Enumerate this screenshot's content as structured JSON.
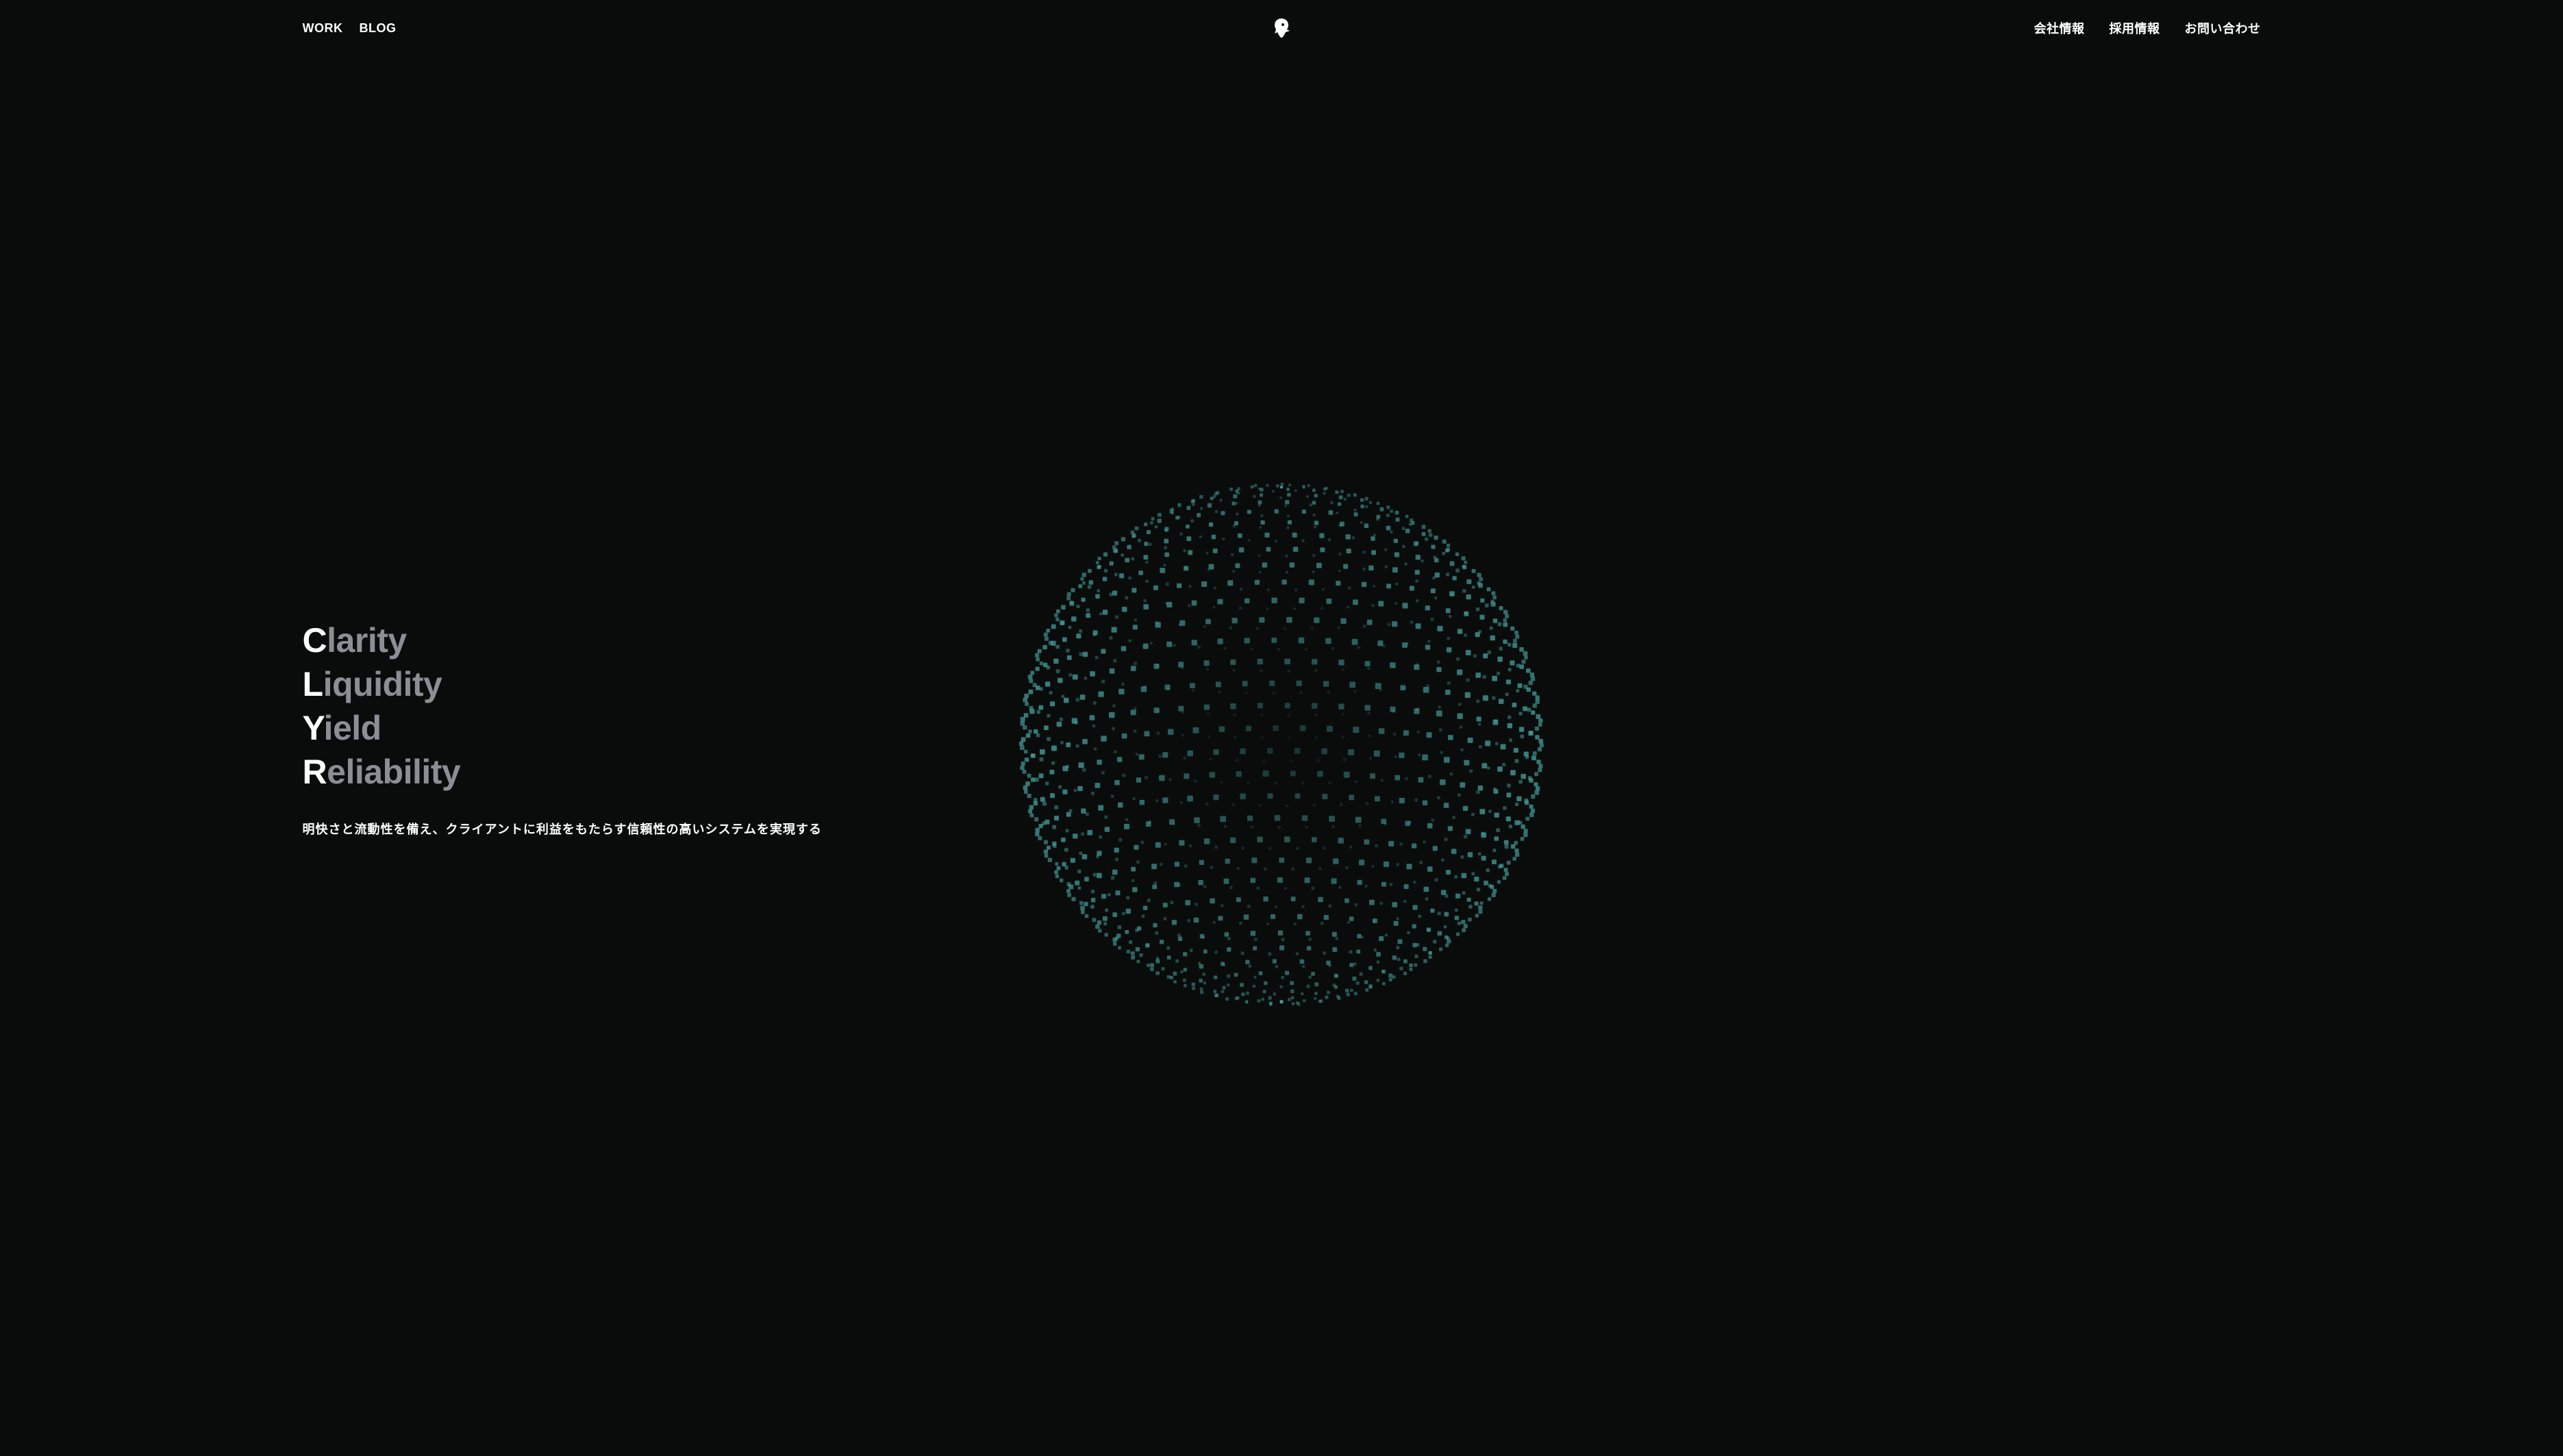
{
  "nav": {
    "left": [
      {
        "label": "WORK"
      },
      {
        "label": "BLOG"
      }
    ],
    "right": [
      {
        "label": "会社情報"
      },
      {
        "label": "採用情報"
      },
      {
        "label": "お問い合わせ"
      }
    ]
  },
  "hero": {
    "acrostic": [
      {
        "initial": "C",
        "rest": "larity"
      },
      {
        "initial": "L",
        "rest": "iquidity"
      },
      {
        "initial": "Y",
        "rest": "ield"
      },
      {
        "initial": "R",
        "rest": "eliability"
      }
    ],
    "tagline": "明快さと流動性を備え、クライアントに利益をもたらす信頼性の高いシステムを実現する"
  },
  "colors": {
    "background": "#0a0c0c",
    "text_primary": "#ffffff",
    "text_muted": "#8b8e94",
    "sphere_accent": "#4aa7a3"
  }
}
